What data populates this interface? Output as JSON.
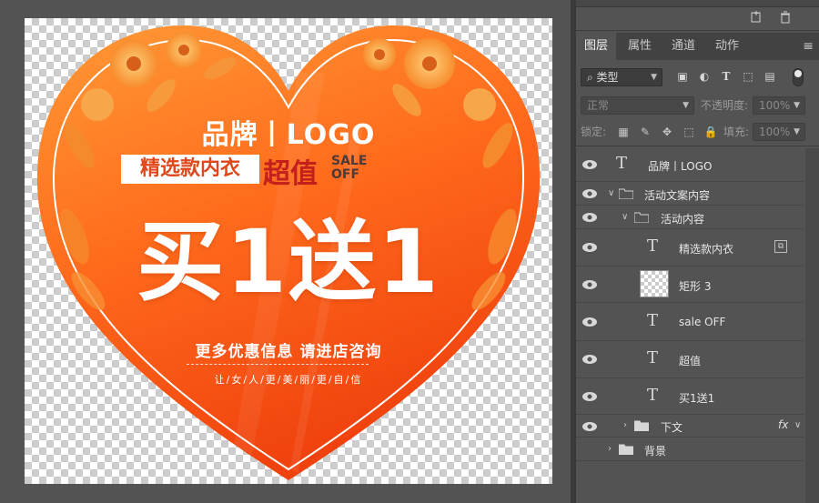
{
  "ad": {
    "brand": "品牌丨LOGO",
    "promo_label": "精选款内衣",
    "super_value": "超值",
    "sale_line1": "SALE",
    "sale_line2": "OFF",
    "headline": "买1送1",
    "sub_line": "更多优惠信息 请进店咨询",
    "slogan": "让/女/人/更/美/丽/更/自/信",
    "colors": {
      "orange_light": "#ff8a2a",
      "orange_dark": "#f04a12",
      "promo_red": "#c3201b"
    }
  },
  "panel": {
    "tabs": [
      "图层",
      "属性",
      "通道",
      "动作"
    ],
    "active_tab": "图层",
    "filter_kind": "类型",
    "blend_mode": "正常",
    "opacity_label": "不透明度:",
    "opacity_value": "100%",
    "lock_label": "锁定:",
    "fill_label": "填充:",
    "fill_value": "100%"
  },
  "layers": [
    {
      "name": "品牌丨LOGO",
      "kind": "text"
    },
    {
      "name": "活动文案内容",
      "kind": "group"
    },
    {
      "name": "活动内容",
      "kind": "group"
    },
    {
      "name": "精选款内衣",
      "kind": "text"
    },
    {
      "name": "矩形 3",
      "kind": "shape"
    },
    {
      "name": "sale OFF",
      "kind": "text"
    },
    {
      "name": "超值",
      "kind": "text"
    },
    {
      "name": "买1送1",
      "kind": "text"
    },
    {
      "name": "下文",
      "kind": "group",
      "fx": "fx"
    },
    {
      "name": "背景",
      "kind": "group"
    }
  ]
}
